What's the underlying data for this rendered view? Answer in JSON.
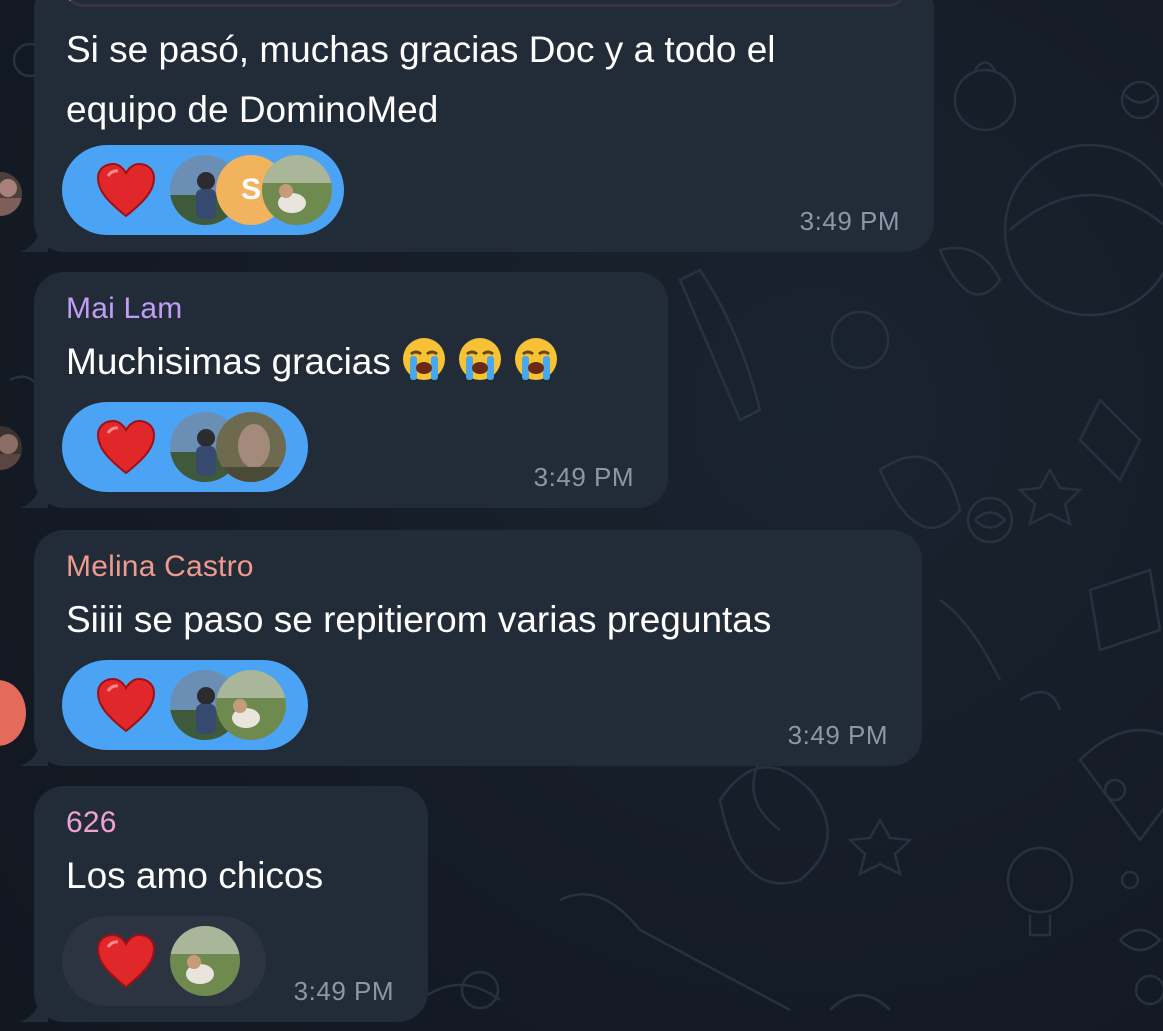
{
  "colors": {
    "background": "#151c26",
    "bubble": "#222b38",
    "reaction_active": "#4ba3f6",
    "reaction_inactive": "#2c3442",
    "time": "#8b97a8",
    "name_mai": "#c29df6",
    "name_melina": "#f09a8c",
    "name_626": "#f0a3d3"
  },
  "messages": [
    {
      "sender": "",
      "text": "Si se pasó, muchas gracias Doc y a todo el\nequipo de DominoMed",
      "reaction_emoji": "red-heart",
      "reaction_avatars": [
        "avatar-photo-man",
        "avatar-initial-s",
        "avatar-photo-outdoor"
      ],
      "avatar_initial": "S",
      "time": "3:49 PM"
    },
    {
      "sender": "Mai Lam",
      "text": "Muchisimas gracias",
      "text_emojis": [
        "loudly-crying-face",
        "loudly-crying-face",
        "loudly-crying-face"
      ],
      "reaction_emoji": "red-heart",
      "reaction_avatars": [
        "avatar-photo-man",
        "avatar-photo-blurred"
      ],
      "time": "3:49 PM"
    },
    {
      "sender": "Melina Castro",
      "text": "Siiii se paso se repitierom varias preguntas",
      "reaction_emoji": "red-heart",
      "reaction_avatars": [
        "avatar-photo-man",
        "avatar-photo-outdoor"
      ],
      "time": "3:49 PM"
    },
    {
      "sender": "626",
      "text": "Los amo chicos",
      "reaction_emoji": "red-heart",
      "reaction_avatars": [
        "avatar-photo-outdoor"
      ],
      "time": "3:49 PM"
    }
  ]
}
